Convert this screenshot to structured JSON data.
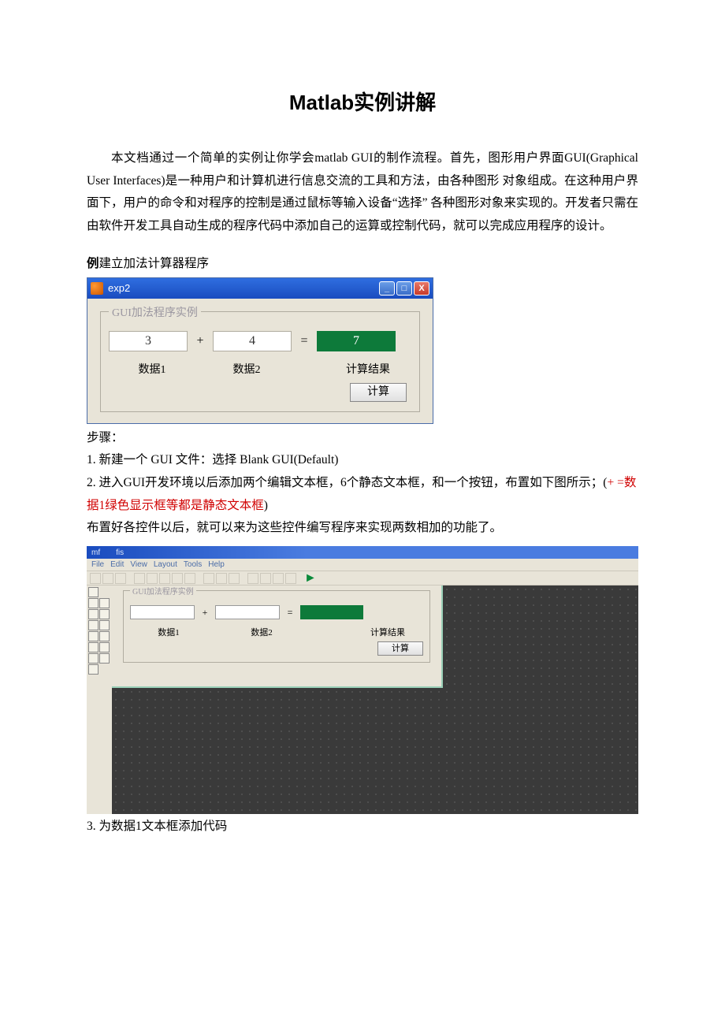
{
  "title": "Matlab实例讲解",
  "intro": "本文档通过一个简单的实例让你学会matlab        GUI的制作流程。首先，图形用户界面GUI(Graphical User Interfaces)是一种用户和计算机进行信息交流的工具和方法，由各种图形 对象组成。在这种用户界面下，用户的命令和对程序的控制是通过鼠标等输入设备“选择” 各种图形对象来实现的。开发者只需在由软件开发工具自动生成的程序代码中添加自己的运算或控制代码，就可以完成应用程序的设计。",
  "example_heading_bold": "例",
  "example_heading_rest": "建立加法计算器程序",
  "window1": {
    "title": "exp2",
    "group_legend": "GUI加法程序实例",
    "input1_value": "3",
    "plus": "+",
    "input2_value": "4",
    "equals": "=",
    "result_value": "7",
    "label1": "数据1",
    "label2": "数据2",
    "label3": "计算结果",
    "calc_button": "计算",
    "btn_min": "_",
    "btn_max": "□",
    "btn_close": "X"
  },
  "steps_header": "步骤：",
  "step1": "1.   新建一个  GUI 文件：选择  Blank GUI(Default)",
  "step2_a": "2.   进入GUI开发环境以后添加两个编辑文本框，6个静态文本框，和一个按钮，布置如下图所示；(",
  "step2_red": "+ =数据1绿色显示框等都是静态文本框",
  "step2_b": ")",
  "step2_c": "布置好各控件以后，就可以来为这些控件编写程序来实现两数相加的功能了。",
  "window2": {
    "top_left": "mf",
    "top_right": "fis",
    "menu": [
      "File",
      "Edit",
      "View",
      "Layout",
      "Tools",
      "Help"
    ],
    "legend": "GUI加法程序实例",
    "plus": "+",
    "equals": "=",
    "label1": "数据1",
    "label2": "数据2",
    "label3": "计算结果",
    "calc_button": "计算",
    "play": "►"
  },
  "step3": "3. 为数据1文本框添加代码"
}
